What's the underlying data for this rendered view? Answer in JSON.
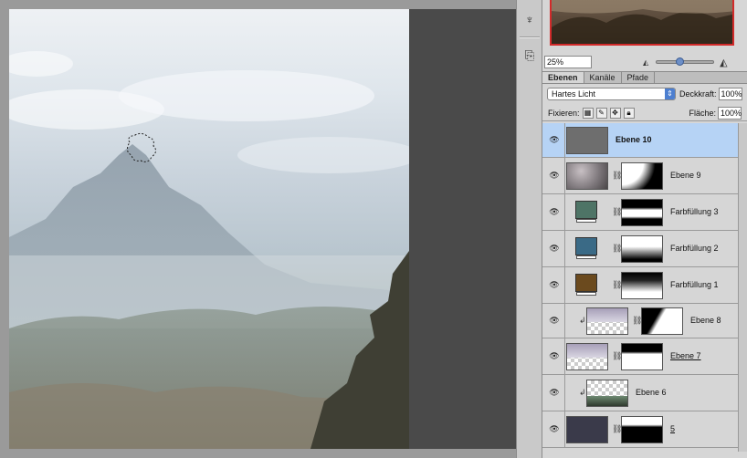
{
  "dock": {
    "icons": [
      "brush-preset-icon",
      "clone-source-icon"
    ]
  },
  "navigator": {
    "zoom_value": "25%",
    "zoom_slider_level": 0.35
  },
  "tabs": [
    {
      "label": "Ebenen",
      "active": true
    },
    {
      "label": "Kanäle",
      "active": false
    },
    {
      "label": "Pfade",
      "active": false
    }
  ],
  "blend": {
    "mode": "Hartes Licht",
    "opacity_label": "Deckkraft:",
    "opacity_value": "100%"
  },
  "lock": {
    "label": "Fixieren:",
    "fill_label": "Fläche:",
    "fill_value": "100%"
  },
  "layers": [
    {
      "name": "Ebene 10",
      "selected": true,
      "bold": true,
      "thumb_color": "#6e6e6e",
      "has_mask": false,
      "clipped": false
    },
    {
      "name": "Ebene 9",
      "selected": false,
      "thumb_color": "#8e8a90",
      "has_mask": true,
      "clipped": false
    },
    {
      "name": "Farbfüllung 3",
      "selected": false,
      "fill_color": "#4e7466",
      "has_mask": true,
      "clipped": false
    },
    {
      "name": "Farbfüllung 2",
      "selected": false,
      "fill_color": "#3a6a86",
      "has_mask": true,
      "clipped": false
    },
    {
      "name": "Farbfüllung 1",
      "selected": false,
      "fill_color": "#6b4a1e",
      "has_mask": true,
      "clipped": false
    },
    {
      "name": "Ebene 8",
      "selected": false,
      "has_mask": true,
      "clipped": true
    },
    {
      "name": "Ebene 7",
      "selected": false,
      "has_mask": true,
      "clipped": false,
      "underlined": true
    },
    {
      "name": "Ebene 6",
      "selected": false,
      "has_mask": false,
      "clipped": true
    },
    {
      "name": "5",
      "selected": false,
      "thumb_color": "#3a3a4a",
      "has_mask": true,
      "clipped": false,
      "underlined": true
    }
  ],
  "colors": {
    "selection": "#b6d3f5",
    "navigator_frame": "#d22a2a",
    "accent": "#4d7fd0"
  }
}
